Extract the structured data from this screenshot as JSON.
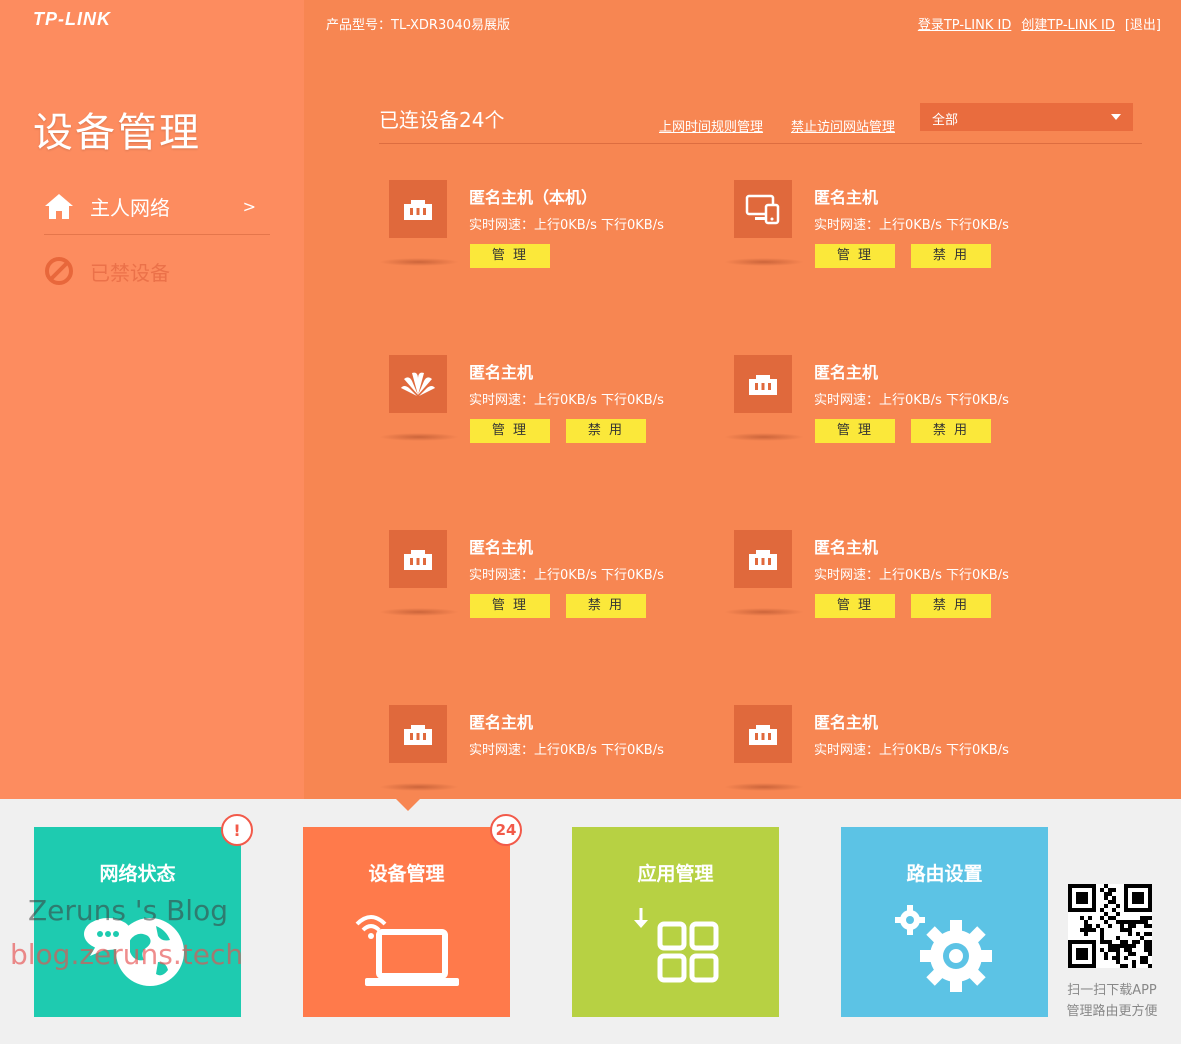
{
  "brand": {
    "logo": "TP-LINK"
  },
  "sidebar": {
    "title": "设备管理",
    "items": [
      {
        "label": "主人网络",
        "chevron": ">"
      },
      {
        "label": "已禁设备"
      }
    ]
  },
  "header": {
    "model": "产品型号：TL-XDR3040易展版",
    "links": [
      "登录TP-LINK ID",
      "创建TP-LINK ID",
      "[退出]"
    ]
  },
  "devices_panel": {
    "count_label": "已连设备24个",
    "links": [
      "上网时间规则管理",
      "禁止访问网站管理"
    ],
    "filter_value": "全部",
    "devices": [
      {
        "name": "匿名主机（本机）",
        "speed": "实时网速：上行0KB/s 下行0KB/s",
        "icon": "ethernet-icon",
        "manage": "管 理",
        "disable": ""
      },
      {
        "name": "匿名主机",
        "speed": "实时网速：上行0KB/s 下行0KB/s",
        "icon": "pc-phone-icon",
        "manage": "管 理",
        "disable": "禁 用"
      },
      {
        "name": "匿名主机",
        "speed": "实时网速：上行0KB/s 下行0KB/s",
        "icon": "huawei-icon",
        "manage": "管 理",
        "disable": "禁 用"
      },
      {
        "name": "匿名主机",
        "speed": "实时网速：上行0KB/s 下行0KB/s",
        "icon": "ethernet-icon",
        "manage": "管 理",
        "disable": "禁 用"
      },
      {
        "name": "匿名主机",
        "speed": "实时网速：上行0KB/s 下行0KB/s",
        "icon": "ethernet-icon",
        "manage": "管 理",
        "disable": "禁 用"
      },
      {
        "name": "匿名主机",
        "speed": "实时网速：上行0KB/s 下行0KB/s",
        "icon": "ethernet-icon",
        "manage": "管 理",
        "disable": "禁 用"
      },
      {
        "name": "匿名主机",
        "speed": "实时网速：上行0KB/s 下行0KB/s",
        "icon": "ethernet-icon",
        "manage": "",
        "disable": ""
      },
      {
        "name": "匿名主机",
        "speed": "实时网速：上行0KB/s 下行0KB/s",
        "icon": "ethernet-icon",
        "manage": "",
        "disable": ""
      }
    ]
  },
  "dock": {
    "tiles": [
      {
        "label": "网络状态",
        "badge": "!",
        "color": "#1ecbb0"
      },
      {
        "label": "设备管理",
        "badge": "24",
        "color": "#ff7a4b"
      },
      {
        "label": "应用管理",
        "badge": "",
        "color": "#b7d143"
      },
      {
        "label": "路由设置",
        "badge": "",
        "color": "#5cc3e5"
      }
    ],
    "qr_caption_1": "扫一扫下载APP",
    "qr_caption_2": "管理路由更方便"
  },
  "watermark": {
    "line1": "Zeruns 's Blog",
    "line2": "blog.zeruns.tech"
  },
  "colors": {
    "sidebar": "#fd8c5f",
    "main": "#f78652",
    "button": "#fbe83a"
  }
}
